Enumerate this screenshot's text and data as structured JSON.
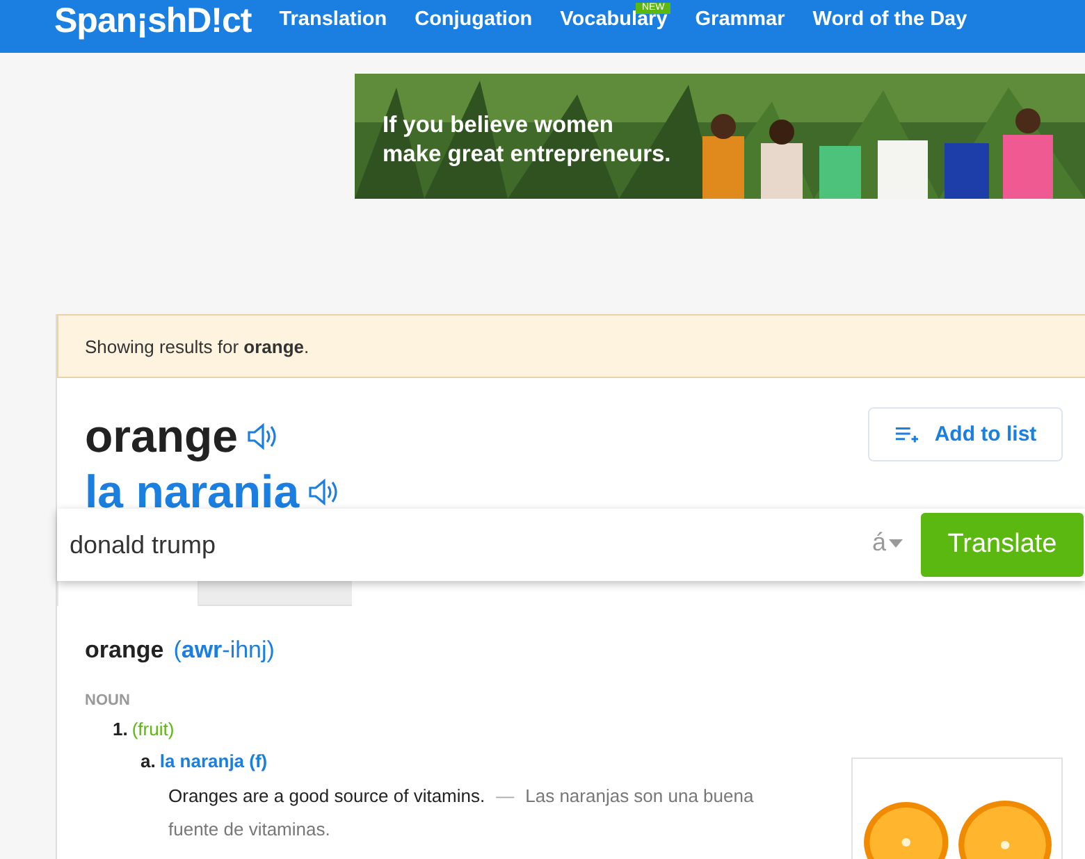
{
  "header": {
    "logo": "Span¡shD!ct",
    "nav": [
      {
        "label": "Translation"
      },
      {
        "label": "Conjugation"
      },
      {
        "label": "Vocabulary",
        "badge": "NEW"
      },
      {
        "label": "Grammar"
      },
      {
        "label": "Word of the Day"
      }
    ]
  },
  "ad": {
    "kind": "picture",
    "headline_lines": [
      "If you believe women",
      "make great entrepreneurs."
    ]
  },
  "notice": {
    "text": "Showing results for **orange**."
  },
  "entry": {
    "headword": "orange",
    "translation": "la narania",
    "add_to_list": "Add to list"
  },
  "search": {
    "value": "donald trump",
    "accent_key": "á",
    "button": "Translate"
  },
  "tabs": [
    {
      "selected": true
    },
    {
      "selected": false
    }
  ],
  "definition": {
    "word": "orange",
    "pronunciation": "(**awr**-ihnj)",
    "part_of_speech": "NOUN",
    "senses": [
      {
        "number": "1.",
        "context": "(fruit)",
        "translations": [
          {
            "letter": "a.",
            "text": "la naranja (f)",
            "example": "Oranges are a good source of vitamins.",
            "separator": "—",
            "example_translation": "Las naranjas son una buena fuente de vitaminas."
          }
        ]
      }
    ]
  }
}
